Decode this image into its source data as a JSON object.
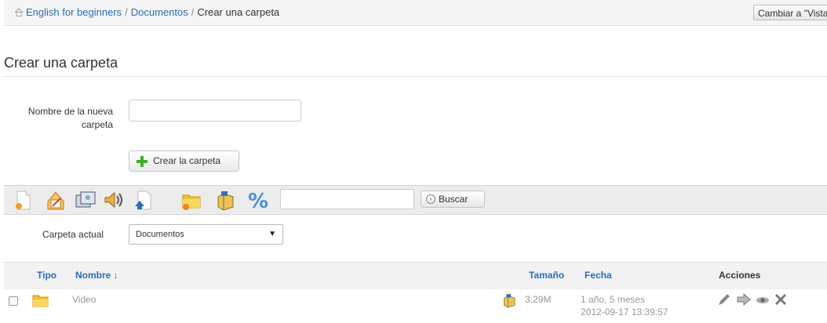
{
  "breadcrumb": {
    "items": [
      "English for beginners",
      "Documentos"
    ],
    "separator": "/",
    "current": "Crear una carpeta"
  },
  "header": {
    "switch_view_label": "Cambiar a \"Vista de alumno\""
  },
  "page": {
    "title": "Crear una carpeta"
  },
  "form": {
    "folder_name_label": "Nombre de la nueva carpeta",
    "folder_name_value": "",
    "create_button_label": "Crear la carpeta"
  },
  "toolbar": {
    "icons": [
      "new-document-icon",
      "new-template-icon",
      "slideshow-icon",
      "audio-icon",
      "upload-icon",
      "new-folder-icon",
      "disk-usage-icon",
      "quota-icon"
    ],
    "search_value": "",
    "search_button_label": "Buscar"
  },
  "current_folder": {
    "label": "Carpeta actual",
    "selected": "Documentos"
  },
  "table": {
    "headers": {
      "type": "Tipo",
      "name": "Nombre ↓",
      "size": "Tamaño",
      "date": "Fecha",
      "actions": "Acciones"
    },
    "rows": [
      {
        "name": "Video",
        "size": "3.29M",
        "date_relative": "1 año, 5 meses",
        "date_absolute": "2012-09-17 13:39:57"
      }
    ]
  },
  "colors": {
    "link": "#2a6ebb",
    "toolbar_bg": "#ececec",
    "header_bg": "#f2f2f2"
  }
}
